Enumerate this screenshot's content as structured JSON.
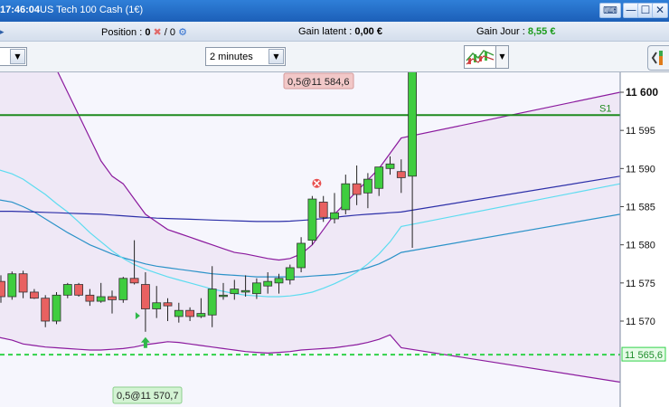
{
  "window": {
    "time": "17:46:04",
    "instrument": "US Tech 100 Cash (1€)",
    "keyboard_icon": "keyboard-icon",
    "minimize_label": "—",
    "maximize_label": "☐",
    "close_label": "✕"
  },
  "position_bar": {
    "position_label": "Position :",
    "position_value": "0",
    "close_position_icon": "red-cross-icon",
    "orders_prefix": "/ 0",
    "orders_icon": "gears-icon",
    "unrealized_label": "Gain latent :",
    "unrealized_value": "0,00 €",
    "daily_label": "Gain Jour :",
    "daily_value": "8,55 €"
  },
  "toolbar": {
    "left_dropdown_value": "",
    "timeframe_value": "2 minutes",
    "indicator_icon": "indicator-chart-icon",
    "sidepanel_icon": "panel-toggle-icon"
  },
  "chart_data": {
    "type": "candlestick",
    "instrument": "US Tech 100 Cash (1€)",
    "timeframe": "2 minutes",
    "price_axis": {
      "range": [
        11562,
        11610
      ],
      "ticks": [
        11570,
        11575,
        11580,
        11585,
        11590,
        11595,
        11600
      ],
      "tick_labels": [
        "11 570",
        "11 575",
        "11 580",
        "11 585",
        "11 590",
        "11 595",
        "11 600"
      ],
      "bold_tick": "11 600"
    },
    "candles": [
      {
        "o": 11575.2,
        "h": 11576.0,
        "l": 11572.4,
        "c": 11573.2
      },
      {
        "o": 11573.2,
        "h": 11576.5,
        "l": 11572.8,
        "c": 11576.2
      },
      {
        "o": 11576.2,
        "h": 11576.6,
        "l": 11573.0,
        "c": 11573.8
      },
      {
        "o": 11573.8,
        "h": 11574.2,
        "l": 11572.9,
        "c": 11573.0
      },
      {
        "o": 11573.0,
        "h": 11573.4,
        "l": 11569.2,
        "c": 11570.0
      },
      {
        "o": 11570.0,
        "h": 11573.8,
        "l": 11569.6,
        "c": 11573.4
      },
      {
        "o": 11573.4,
        "h": 11575.0,
        "l": 11573.0,
        "c": 11574.8
      },
      {
        "o": 11574.8,
        "h": 11575.0,
        "l": 11573.2,
        "c": 11573.4
      },
      {
        "o": 11573.4,
        "h": 11574.2,
        "l": 11572.0,
        "c": 11572.6
      },
      {
        "o": 11572.6,
        "h": 11575.0,
        "l": 11572.4,
        "c": 11573.2
      },
      {
        "o": 11573.2,
        "h": 11574.0,
        "l": 11571.0,
        "c": 11572.8
      },
      {
        "o": 11572.8,
        "h": 11575.8,
        "l": 11572.4,
        "c": 11575.6
      },
      {
        "o": 11575.6,
        "h": 11580.6,
        "l": 11574.8,
        "c": 11575.0
      },
      {
        "o": 11574.8,
        "h": 11576.4,
        "l": 11568.6,
        "c": 11571.6
      },
      {
        "o": 11571.6,
        "h": 11574.6,
        "l": 11570.4,
        "c": 11572.4
      },
      {
        "o": 11572.4,
        "h": 11573.0,
        "l": 11570.0,
        "c": 11572.0
      },
      {
        "o": 11570.6,
        "h": 11572.4,
        "l": 11569.8,
        "c": 11571.4
      },
      {
        "o": 11571.4,
        "h": 11571.8,
        "l": 11570.0,
        "c": 11570.6
      },
      {
        "o": 11570.6,
        "h": 11573.0,
        "l": 11570.4,
        "c": 11571.0
      },
      {
        "o": 11570.8,
        "h": 11577.2,
        "l": 11569.2,
        "c": 11574.2
      },
      {
        "o": 11573.4,
        "h": 11575.0,
        "l": 11572.8,
        "c": 11573.4
      },
      {
        "o": 11573.6,
        "h": 11575.4,
        "l": 11572.8,
        "c": 11574.2
      },
      {
        "o": 11573.8,
        "h": 11576.0,
        "l": 11573.2,
        "c": 11574.0
      },
      {
        "o": 11573.6,
        "h": 11575.6,
        "l": 11572.9,
        "c": 11575.0
      },
      {
        "o": 11574.6,
        "h": 11576.4,
        "l": 11573.6,
        "c": 11575.2
      },
      {
        "o": 11575.0,
        "h": 11576.2,
        "l": 11573.6,
        "c": 11575.6
      },
      {
        "o": 11575.4,
        "h": 11577.4,
        "l": 11574.8,
        "c": 11577.0
      },
      {
        "o": 11577.0,
        "h": 11581.0,
        "l": 11576.4,
        "c": 11580.2
      },
      {
        "o": 11580.6,
        "h": 11586.4,
        "l": 11580.0,
        "c": 11586.0
      },
      {
        "o": 11585.6,
        "h": 11586.4,
        "l": 11583.0,
        "c": 11583.6
      },
      {
        "o": 11583.4,
        "h": 11586.8,
        "l": 11582.8,
        "c": 11584.2
      },
      {
        "o": 11584.6,
        "h": 11589.2,
        "l": 11584.0,
        "c": 11588.0
      },
      {
        "o": 11588.0,
        "h": 11590.4,
        "l": 11585.2,
        "c": 11586.6
      },
      {
        "o": 11586.8,
        "h": 11589.4,
        "l": 11584.8,
        "c": 11588.6
      },
      {
        "o": 11587.4,
        "h": 11590.0,
        "l": 11586.4,
        "c": 11590.2
      },
      {
        "o": 11590.0,
        "h": 11591.6,
        "l": 11589.2,
        "c": 11590.6
      },
      {
        "o": 11589.6,
        "h": 11591.2,
        "l": 11586.8,
        "c": 11588.8
      },
      {
        "o": 11589.0,
        "h": 11610.0,
        "l": 11579.6,
        "c": 11610.0
      }
    ],
    "bollinger_upper": [
      11612,
      11611,
      11610,
      11608,
      11606,
      11603,
      11600,
      11597,
      11594,
      11591,
      11589,
      11588,
      11586,
      11584,
      11583,
      11582,
      11581.5,
      11581,
      11580.5,
      11580,
      11579.5,
      11579,
      11578.8,
      11578.5,
      11578.2,
      11578,
      11578.2,
      11578.8,
      11580,
      11582,
      11584,
      11585.5,
      11587,
      11588.5,
      11590,
      11592,
      11594,
      11600
    ],
    "bollinger_middle": [
      11579,
      11578.5,
      11578,
      11577.5,
      11577,
      11576.5,
      11576,
      11575.6,
      11575.2,
      11575,
      11574.6,
      11574.2,
      11574,
      11573.8,
      11573.6,
      11573.4,
      11573.3,
      11573.2,
      11573.2,
      11573.2,
      11573.3,
      11573.4,
      11573.5,
      11573.7,
      11573.9,
      11574.1,
      11574.5,
      11575.2,
      11576.2,
      11577.2,
      11578.2,
      11579.5,
      11581,
      11582.5,
      11584,
      11585.2,
      11586.5,
      11589
    ],
    "bollinger_lower": [
      11568,
      11567.5,
      11567,
      11566.8,
      11566.6,
      11566.5,
      11566.4,
      11566.3,
      11566.2,
      11566.2,
      11566.3,
      11566.4,
      11566.6,
      11566.9,
      11567.1,
      11567.3,
      11567.2,
      11567.0,
      11566.8,
      11566.6,
      11566.4,
      11566.2,
      11566,
      11565.9,
      11565.8,
      11565.9,
      11566,
      11566.2,
      11566.3,
      11566.4,
      11566.5,
      11566.7,
      11566.9,
      11567.2,
      11567.6,
      11568.2,
      11566.5,
      11562
    ],
    "ma_short": [
      11590,
      11589.3,
      11588.6,
      11587.6,
      11586.6,
      11585.4,
      11584.3,
      11583,
      11581.6,
      11580.4,
      11579.2,
      11578.2,
      11577.4,
      11576.8,
      11576.3,
      11575.8,
      11575.4,
      11575,
      11574.6,
      11574.2,
      11573.9,
      11573.6,
      11573.4,
      11573.3,
      11573.2,
      11573.2,
      11573.3,
      11573.5,
      11573.8,
      11574.3,
      11574.9,
      11575.6,
      11576.4,
      11577.5,
      11578.8,
      11580.4,
      11582.4,
      11588
    ],
    "ma_mid": [
      11584.4,
      11584.4,
      11584.35,
      11584.3,
      11584.25,
      11584.2,
      11584.15,
      11584.1,
      11584.05,
      11584.0,
      11583.9,
      11583.8,
      11583.7,
      11583.6,
      11583.5,
      11583.45,
      11583.4,
      11583.35,
      11583.3,
      11583.25,
      11583.2,
      11583.15,
      11583.1,
      11583.05,
      11583.05,
      11583.05,
      11583.1,
      11583.2,
      11583.3,
      11583.45,
      11583.6,
      11583.75,
      11583.9,
      11584.0,
      11584.1,
      11584.2,
      11584.3,
      11589
    ],
    "ma_long": [
      11586,
      11585.6,
      11585,
      11584.3,
      11583.4,
      11582.5,
      11581.6,
      11580.8,
      11580,
      11579.4,
      11578.8,
      11578.3,
      11577.9,
      11577.5,
      11577.2,
      11577,
      11576.8,
      11576.6,
      11576.4,
      11576.2,
      11576.1,
      11576,
      11575.9,
      11575.8,
      11575.8,
      11575.8,
      11575.8,
      11575.8,
      11575.9,
      11576,
      11576.1,
      11576.3,
      11576.6,
      11577,
      11577.5,
      11578.2,
      11579,
      11584
    ],
    "support_line": {
      "price": 11597,
      "label": "S1"
    },
    "stop_line": {
      "price": 11565.6,
      "label": "11 565,6"
    },
    "order_labels": [
      {
        "text": "0,5@11 584,6",
        "type": "sell"
      },
      {
        "text": "0,5@11 570,7",
        "type": "buy"
      }
    ],
    "markers": [
      {
        "type": "sell-exit",
        "icon": "red-x-icon",
        "candle": 28
      },
      {
        "type": "buy-entry",
        "icon": "green-up-arrow-icon",
        "candle": 13
      }
    ],
    "colors": {
      "bullish": "#3fcd3f",
      "bearish": "#e86161",
      "bollinger": "#8b1a9e",
      "bollinger_fill": "#efe8f6",
      "ma_short": "#5ddcf0",
      "ma_mid": "#2c2fa8",
      "ma_long": "#2b92c8",
      "support": "#1e8a1e",
      "stop": "#31d24a"
    },
    "grid": false
  }
}
